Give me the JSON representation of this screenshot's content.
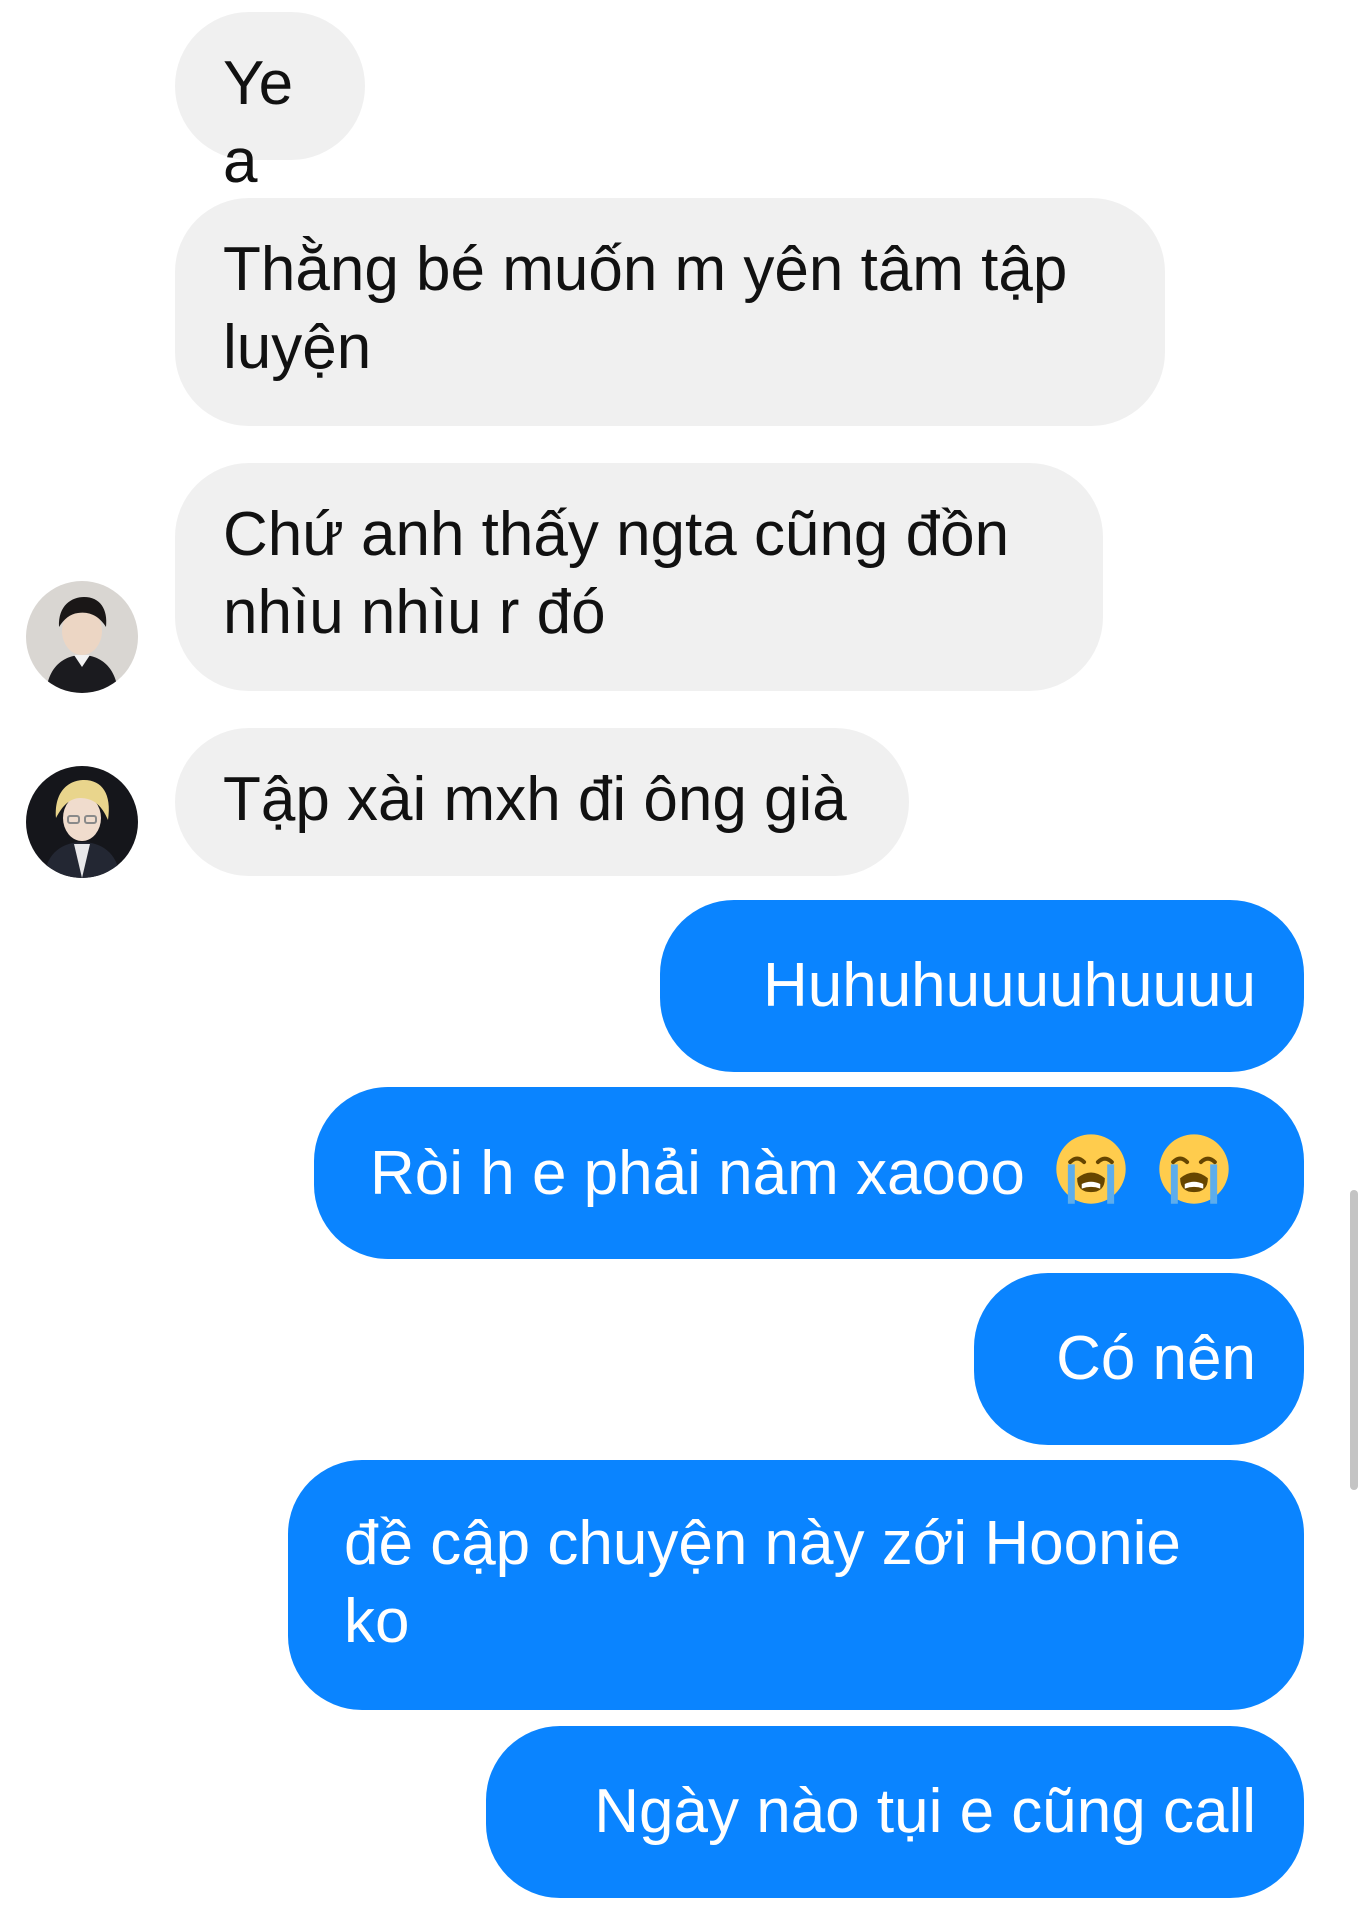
{
  "conversation": {
    "messages": [
      {
        "from": "other",
        "text": "Yea"
      },
      {
        "from": "other",
        "text": "Thằng bé muốn m yên tâm tập luyện"
      },
      {
        "from": "other",
        "text": "Chứ anh thấy ngta cũng đồn nhìu nhìu r đó"
      },
      {
        "from": "other",
        "text": "Tập xài mxh đi ông già"
      },
      {
        "from": "me",
        "text": "Huhuhuuuuhuuuu"
      },
      {
        "from": "me",
        "text": "Ròi h e phải nàm xaooo",
        "emoji": [
          "loudly-crying-face",
          "loudly-crying-face"
        ]
      },
      {
        "from": "me",
        "text": "Có nên"
      },
      {
        "from": "me",
        "text": "đề cập chuyện này zới Hoonie ko"
      },
      {
        "from": "me",
        "text": "Ngày nào tụi e cũng call"
      }
    ]
  },
  "colors": {
    "incoming_bubble": "#f0f0f0",
    "outgoing_bubble": "#0a84ff",
    "incoming_text": "#111111",
    "outgoing_text": "#ffffff"
  },
  "icons": {
    "avatar_1": "user-avatar-dark-hair",
    "avatar_2": "user-avatar-blonde-hair",
    "emoji": "loudly-crying-face"
  }
}
